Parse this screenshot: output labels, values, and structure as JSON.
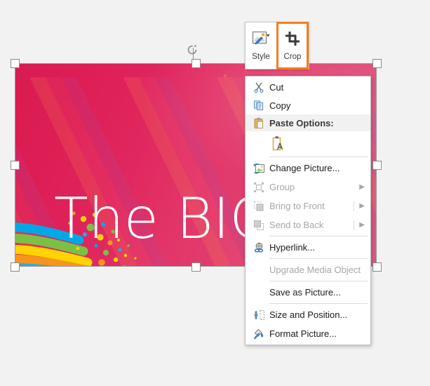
{
  "picture": {
    "title_text": "The BIG",
    "alt_name": "decorative-pink-gradient-slide-image",
    "accent_pink": "#e2215c",
    "swoosh_colors": [
      "#00a8e8",
      "#7ac143",
      "#ffd400",
      "#f7941e",
      "#29abe2"
    ]
  },
  "selection": {
    "rotate_handle_name": "rotation-handle",
    "handles": [
      "top-left",
      "top-center",
      "top-right",
      "middle-left",
      "middle-right",
      "bottom-left",
      "bottom-center",
      "bottom-right"
    ]
  },
  "mini_toolbar": {
    "buttons": [
      {
        "id": "style",
        "label": "Style",
        "icon": "picture-style-icon",
        "highlighted": false,
        "has_dropdown": true
      },
      {
        "id": "crop",
        "label": "Crop",
        "icon": "crop-icon",
        "highlighted": true,
        "has_dropdown": false
      }
    ],
    "highlight_color": "#f57c20"
  },
  "context_menu": {
    "items": [
      {
        "id": "cut",
        "label": "Cut",
        "icon": "scissors-icon",
        "enabled": true,
        "submenu": false,
        "accel": "t"
      },
      {
        "id": "copy",
        "label": "Copy",
        "icon": "copy-icon",
        "enabled": true,
        "submenu": false,
        "accel": "C"
      },
      {
        "id": "paste-options",
        "label": "Paste Options:",
        "icon": "clipboard-icon",
        "enabled": true,
        "submenu": false,
        "header": true
      },
      {
        "id": "paste-keep-text",
        "label": "",
        "icon": "paste-text-icon",
        "enabled": true,
        "submenu": false,
        "gallery": true
      },
      {
        "id": "change-picture",
        "label": "Change Picture...",
        "icon": "change-picture-icon",
        "enabled": true,
        "submenu": false,
        "accel": "n"
      },
      {
        "id": "group",
        "label": "Group",
        "icon": "group-icon",
        "enabled": false,
        "submenu": true,
        "accel": "G"
      },
      {
        "id": "bring-to-front",
        "label": "Bring to Front",
        "icon": "bring-to-front-icon",
        "enabled": false,
        "submenu": true,
        "accel": "r"
      },
      {
        "id": "send-to-back",
        "label": "Send to Back",
        "icon": "send-to-back-icon",
        "enabled": false,
        "submenu": true,
        "accel": "k"
      },
      {
        "id": "hyperlink",
        "label": "Hyperlink...",
        "icon": "hyperlink-icon",
        "enabled": true,
        "submenu": false,
        "accel": "H"
      },
      {
        "id": "upgrade-media",
        "label": "Upgrade Media Object",
        "icon": "",
        "enabled": false,
        "submenu": false,
        "accel": "U"
      },
      {
        "id": "save-as-picture",
        "label": "Save as Picture...",
        "icon": "",
        "enabled": true,
        "submenu": false,
        "accel": "S"
      },
      {
        "id": "size-position",
        "label": "Size and Position...",
        "icon": "size-position-icon",
        "enabled": true,
        "submenu": false,
        "accel": "z"
      },
      {
        "id": "format-picture",
        "label": "Format Picture...",
        "icon": "format-picture-icon",
        "enabled": true,
        "submenu": false,
        "accel": "o"
      }
    ]
  }
}
